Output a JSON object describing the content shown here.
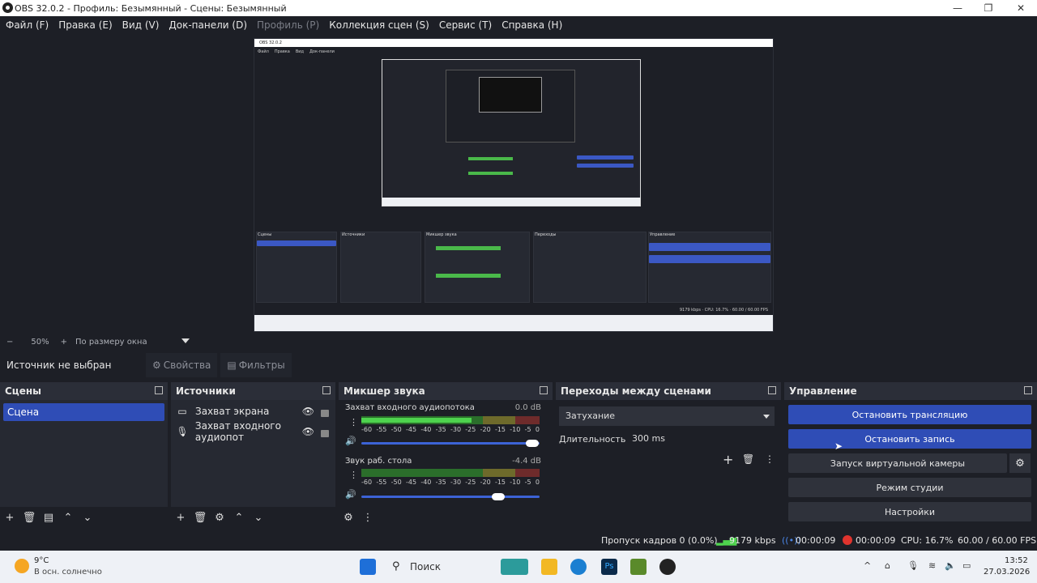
{
  "window": {
    "title": "OBS 32.0.2 - Профиль: Безымянный - Сцены: Безымянный"
  },
  "menu": [
    {
      "label": "Файл (F)",
      "disabled": false
    },
    {
      "label": "Правка (E)",
      "disabled": false
    },
    {
      "label": "Вид (V)",
      "disabled": false
    },
    {
      "label": "Док-панели (D)",
      "disabled": false
    },
    {
      "label": "Профиль (P)",
      "disabled": true
    },
    {
      "label": "Коллекция сцен (S)",
      "disabled": false
    },
    {
      "label": "Сервис (T)",
      "disabled": false
    },
    {
      "label": "Справка (H)",
      "disabled": false
    }
  ],
  "zoom": {
    "minus": "−",
    "percent": "50%",
    "plus": "+",
    "mode": "По размеру окна"
  },
  "source_toolbar": {
    "no_source": "Источник не выбран",
    "properties": "Свойства",
    "filters": "Фильтры"
  },
  "scenes": {
    "title": "Сцены",
    "items": [
      "Сцена"
    ]
  },
  "sources": {
    "title": "Источники",
    "items": [
      "Захват экрана",
      "Захват входного аудиопот"
    ]
  },
  "mixer": {
    "title": "Микшер звука",
    "channels": [
      {
        "name": "Захват входного аудиопотока",
        "db": "0.0 dB",
        "level": 0.62,
        "volume": 0.96
      },
      {
        "name": "Звук раб. стола",
        "db": "-4.4 dB",
        "level": 0.0,
        "volume": 0.77
      }
    ],
    "scale": [
      "-60",
      "-55",
      "-50",
      "-45",
      "-40",
      "-35",
      "-30",
      "-25",
      "-20",
      "-15",
      "-10",
      "-5",
      "0"
    ]
  },
  "transitions": {
    "title": "Переходы между сценами",
    "selected": "Затухание",
    "duration_label": "Длительность",
    "duration_value": "300 ms"
  },
  "controls": {
    "title": "Управление",
    "stop_stream": "Остановить трансляцию",
    "stop_record": "Остановить запись",
    "virtual_cam": "Запуск виртуальной камеры",
    "studio_mode": "Режим студии",
    "settings": "Настройки"
  },
  "status": {
    "dropped": "Пропуск кадров 0 (0.0%)",
    "bitrate": "9179 kbps",
    "stream_time": "00:00:09",
    "rec_time": "00:00:09",
    "cpu": "CPU: 16.7%",
    "fps": "60.00 / 60.00 FPS"
  },
  "taskbar": {
    "weather_temp": "9°C",
    "weather_desc": "В осн. солнечно",
    "search": "Поиск",
    "time": "13:52",
    "date": "27.03.2026"
  },
  "colors": {
    "accent": "#2f4db6",
    "bg": "#1d1f26",
    "panel": "#262932",
    "header": "#2b2e38",
    "meter_green": "#4ed34e",
    "rec_red": "#e0342e"
  }
}
